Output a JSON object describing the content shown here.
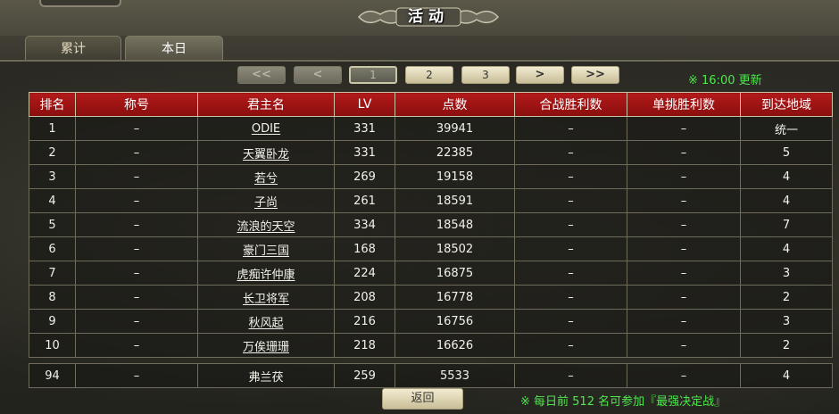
{
  "title": "活动",
  "tabs": [
    {
      "label": "累计",
      "active": false
    },
    {
      "label": "本日",
      "active": true
    }
  ],
  "pagination": {
    "first": "<<",
    "prev": "<",
    "pages": [
      "1",
      "2",
      "3"
    ],
    "current": "1",
    "next": ">",
    "last": ">>"
  },
  "update_note": "※ 16:00 更新",
  "table": {
    "headers": [
      "排名",
      "称号",
      "君主名",
      "LV",
      "点数",
      "合战胜利数",
      "单挑胜利数",
      "到达地域"
    ],
    "rows": [
      [
        "1",
        "–",
        "ODIE",
        "331",
        "39941",
        "–",
        "–",
        "统一"
      ],
      [
        "2",
        "–",
        "天翼卧龙",
        "331",
        "22385",
        "–",
        "–",
        "5"
      ],
      [
        "3",
        "–",
        "若兮",
        "269",
        "19158",
        "–",
        "–",
        "4"
      ],
      [
        "4",
        "–",
        "子尚",
        "261",
        "18591",
        "–",
        "–",
        "4"
      ],
      [
        "5",
        "–",
        "流浪的天空",
        "334",
        "18548",
        "–",
        "–",
        "7"
      ],
      [
        "6",
        "–",
        "豪门三国",
        "168",
        "18502",
        "–",
        "–",
        "4"
      ],
      [
        "7",
        "–",
        "虎痴许仲康",
        "224",
        "16875",
        "–",
        "–",
        "3"
      ],
      [
        "8",
        "–",
        "长卫将军",
        "208",
        "16778",
        "–",
        "–",
        "2"
      ],
      [
        "9",
        "–",
        "秋风起",
        "216",
        "16756",
        "–",
        "–",
        "3"
      ],
      [
        "10",
        "–",
        "万俟珊珊",
        "218",
        "16626",
        "–",
        "–",
        "2"
      ]
    ],
    "self_row": [
      "94",
      "–",
      "弗兰茯",
      "259",
      "5533",
      "–",
      "–",
      "4"
    ]
  },
  "back_label": "返回",
  "footer_note": "※ 每日前 512 名可参加『最强决定战』",
  "colors": {
    "header_red": "#b21a1a",
    "note_green": "#4ce84c",
    "button_cream": "#f1ead0"
  }
}
